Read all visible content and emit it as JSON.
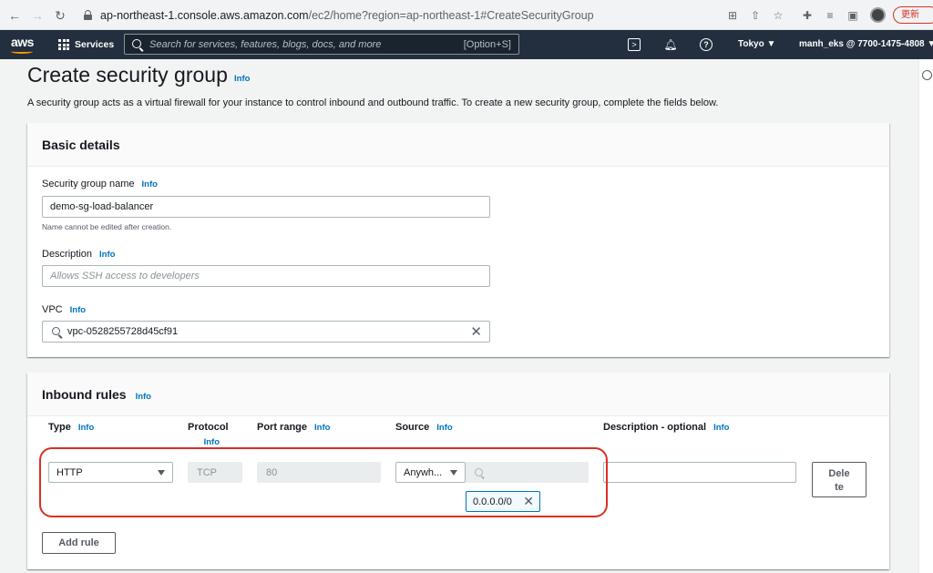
{
  "browser": {
    "url_host": "ap-northeast-1.console.aws.amazon.com",
    "url_path": "/ec2/home?region=ap-northeast-1#CreateSecurityGroup",
    "update_label": "更新"
  },
  "aws_bar": {
    "logo": "aws",
    "services_label": "Services",
    "search_placeholder": "Search for services, features, blogs, docs, and more",
    "search_shortcut": "[Option+S]",
    "region": "Tokyo ▼",
    "account": "manh_eks @ 7700-1475-4808 ▼"
  },
  "page": {
    "title": "Create security group",
    "title_info": "Info",
    "description": "A security group acts as a virtual firewall for your instance to control inbound and outbound traffic. To create a new security group, complete the fields below."
  },
  "basic_details": {
    "heading": "Basic details",
    "name_label": "Security group name",
    "name_info": "Info",
    "name_value": "demo-sg-load-balancer",
    "name_hint": "Name cannot be edited after creation.",
    "description_label": "Description",
    "description_info": "Info",
    "description_placeholder": "Allows SSH access to developers",
    "vpc_label": "VPC",
    "vpc_info": "Info",
    "vpc_value": "vpc-0528255728d45cf91"
  },
  "inbound_rules": {
    "heading": "Inbound rules",
    "heading_info": "Info",
    "columns": {
      "type": "Type",
      "type_info": "Info",
      "protocol": "Protocol",
      "protocol_info": "Info",
      "port_range": "Port range",
      "port_info": "Info",
      "source": "Source",
      "source_info": "Info",
      "description": "Description - optional",
      "description_info": "Info"
    },
    "rule": {
      "type": "HTTP",
      "protocol": "TCP",
      "port_range": "80",
      "source_type": "Anywh...",
      "source_token": "0.0.0.0/0",
      "description": "",
      "delete_line1": "Dele",
      "delete_line2": "te"
    },
    "add_rule_label": "Add rule"
  },
  "colors": {
    "aws_bar": "#232f3e",
    "aws_orange": "#ff9900",
    "link": "#0073bb",
    "highlight": "#d93025"
  }
}
